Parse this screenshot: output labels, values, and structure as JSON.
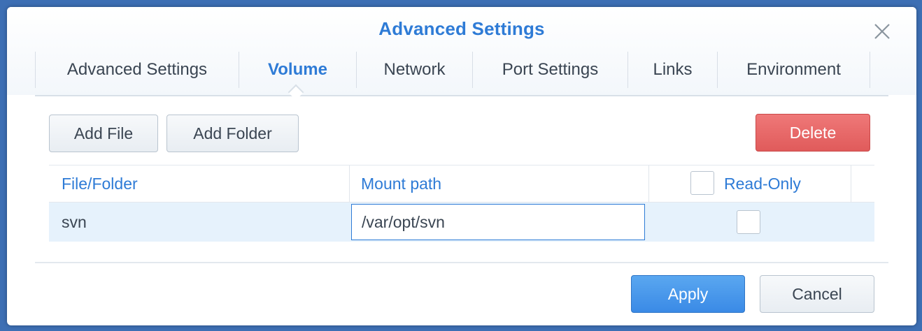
{
  "dialog": {
    "title": "Advanced Settings",
    "close_icon": "close-icon"
  },
  "tabs": [
    {
      "label": "Advanced Settings",
      "active": false
    },
    {
      "label": "Volume",
      "active": true
    },
    {
      "label": "Network",
      "active": false
    },
    {
      "label": "Port Settings",
      "active": false
    },
    {
      "label": "Links",
      "active": false
    },
    {
      "label": "Environment",
      "active": false
    }
  ],
  "toolbar": {
    "add_file_label": "Add File",
    "add_folder_label": "Add Folder",
    "delete_label": "Delete"
  },
  "table": {
    "columns": [
      "File/Folder",
      "Mount path",
      "Read-Only"
    ],
    "header_read_only_checked": false,
    "rows": [
      {
        "file_folder": "svn",
        "mount_path": "/var/opt/svn",
        "read_only": false
      }
    ]
  },
  "footer": {
    "apply_label": "Apply",
    "cancel_label": "Cancel"
  },
  "colors": {
    "accent": "#2e7bd6",
    "danger": "#e05b5b",
    "primary_button": "#3a8ae6",
    "selected_row": "#e6f2fc",
    "background": "#3d6fb4"
  }
}
